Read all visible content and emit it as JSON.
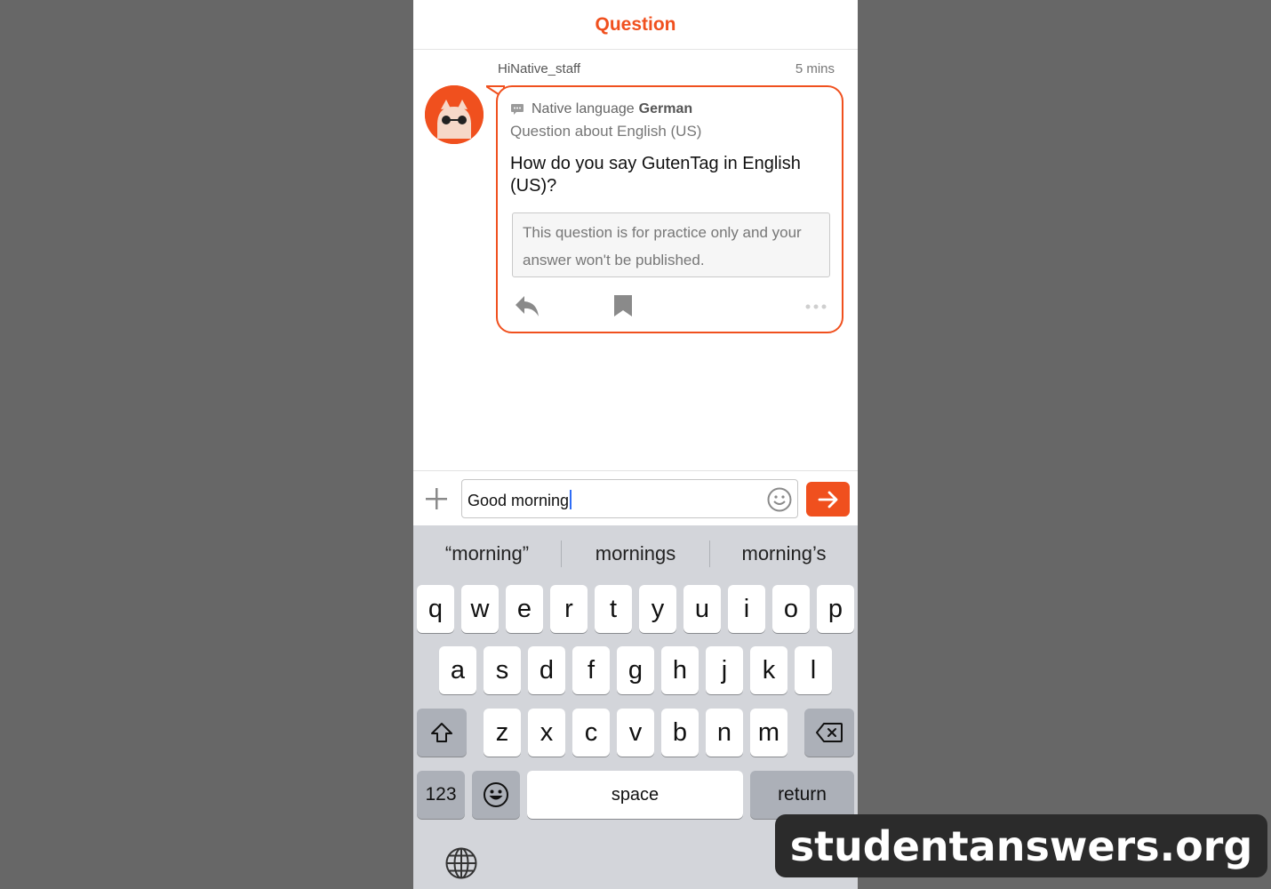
{
  "nav": {
    "title": "Question"
  },
  "post": {
    "author": "HiNative_staff",
    "time": "5 mins",
    "native_language_label": "Native language",
    "native_language": "German",
    "question_about": "Question about English (US)",
    "question": "How do you say GutenTag in English (US)?",
    "notice": "This question is for practice only and your answer won't be published.",
    "actions": [
      "reply-icon",
      "bookmark-icon",
      "more-icon"
    ]
  },
  "composer": {
    "input_value": "Good morning",
    "icons": [
      "plus-icon",
      "emoji-icon",
      "send-arrow-icon"
    ]
  },
  "keyboard": {
    "suggestions": [
      "“morning”",
      "mornings",
      "morning’s"
    ],
    "row1": [
      "q",
      "w",
      "e",
      "r",
      "t",
      "y",
      "u",
      "i",
      "o",
      "p"
    ],
    "row2": [
      "a",
      "s",
      "d",
      "f",
      "g",
      "h",
      "j",
      "k",
      "l"
    ],
    "row3": [
      "z",
      "x",
      "c",
      "v",
      "b",
      "n",
      "m"
    ],
    "numbers_label": "123",
    "space_label": "space",
    "return_label": "return",
    "icons": [
      "shift-icon",
      "backspace-icon",
      "emoji-key-icon",
      "globe-icon"
    ]
  },
  "colors": {
    "accent": "#f0501e",
    "keyboard_bg": "#d3d5da",
    "page_bg": "#676767"
  },
  "watermark": "studentanswers.org"
}
